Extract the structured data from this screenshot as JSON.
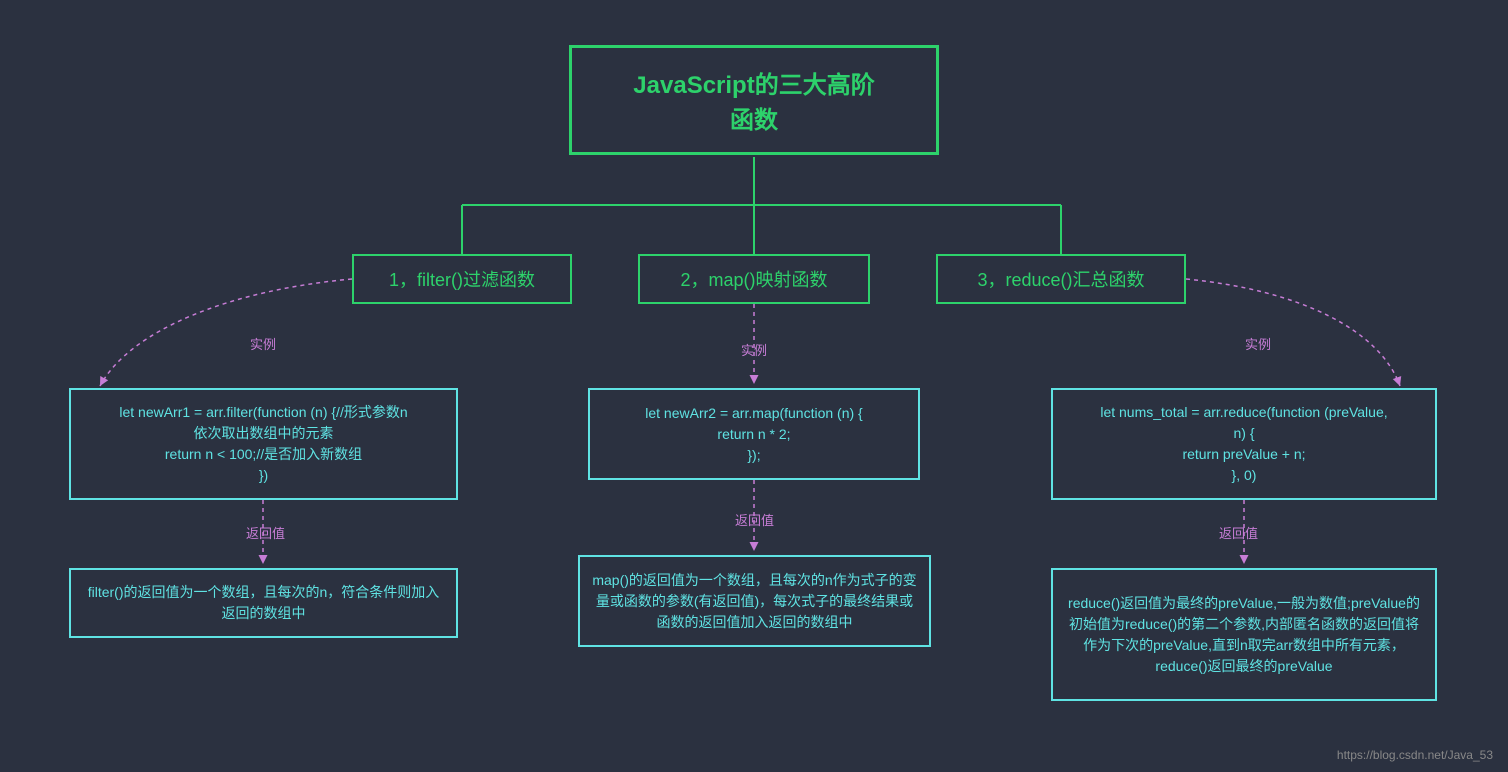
{
  "root": {
    "title_line1": "JavaScript的三大高阶",
    "title_line2": "函数"
  },
  "categories": {
    "filter": "1，filter()过滤函数",
    "map": "2，map()映射函数",
    "reduce": "3，reduce()汇总函数"
  },
  "labels": {
    "example": "实例",
    "return": "返回值"
  },
  "examples": {
    "filter_l1": "let newArr1 = arr.filter(function (n) {//形式参数n",
    "filter_l2": "依次取出数组中的元素",
    "filter_l3": "return n < 100;//是否加入新数组",
    "filter_l4": "})",
    "map_l1": "let newArr2 = arr.map(function (n) {",
    "map_l2": "return n * 2;",
    "map_l3": "});",
    "reduce_l1": "let nums_total = arr.reduce(function (preValue,",
    "reduce_l2": "n) {",
    "reduce_l3": "return preValue + n;",
    "reduce_l4": "}, 0)"
  },
  "returns": {
    "filter": "filter()的返回值为一个数组，且每次的n，符合条件则加入返回的数组中",
    "map": "map()的返回值为一个数组，且每次的n作为式子的变量或函数的参数(有返回值)，每次式子的最终结果或函数的返回值加入返回的数组中",
    "reduce": "reduce()返回值为最终的preValue,一般为数值;preValue的初始值为reduce()的第二个参数,内部匿名函数的返回值将作为下次的preValue,直到n取完arr数组中所有元素，reduce()返回最终的preValue"
  },
  "watermark": "https://blog.csdn.net/Java_53"
}
